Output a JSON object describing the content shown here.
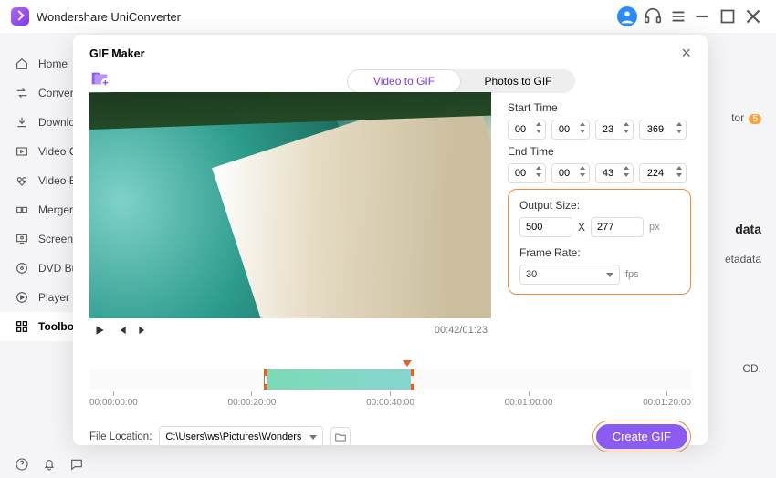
{
  "app": {
    "title": "Wondershare UniConverter"
  },
  "sidebar": {
    "items": [
      {
        "label": "Home"
      },
      {
        "label": "Converter"
      },
      {
        "label": "Downloader"
      },
      {
        "label": "Video Compressor"
      },
      {
        "label": "Video Editor"
      },
      {
        "label": "Merger"
      },
      {
        "label": "Screen Recorder"
      },
      {
        "label": "DVD Burner"
      },
      {
        "label": "Player"
      },
      {
        "label": "Toolbox"
      }
    ]
  },
  "bg": {
    "tor": "tor",
    "badge": "5",
    "data": "data",
    "etadata": "etadata",
    "cd": "CD."
  },
  "modal": {
    "title": "GIF Maker",
    "tabs": {
      "video": "Video to GIF",
      "photos": "Photos to GIF"
    },
    "video": {
      "time": "00:42/01:23"
    },
    "start": {
      "label": "Start Time",
      "h": "00",
      "m": "00",
      "s": "23",
      "ms": "369"
    },
    "end": {
      "label": "End Time",
      "h": "00",
      "m": "00",
      "s": "43",
      "ms": "224"
    },
    "output": {
      "label": "Output Size:",
      "w": "500",
      "x": "X",
      "h": "277",
      "px": "px"
    },
    "frame": {
      "label": "Frame Rate:",
      "value": "30",
      "unit": "fps"
    },
    "timeline": {
      "ticks": [
        "00:00:00:00",
        "00:00:20:00",
        "00:00:40:00",
        "00:01:00:00",
        "00:01:20:00"
      ],
      "range_left_pct": 29,
      "range_width_pct": 25,
      "playhead_pct": 52
    },
    "file": {
      "label": "File Location:",
      "path": "C:\\Users\\ws\\Pictures\\Wonders"
    },
    "create": "Create GIF"
  }
}
